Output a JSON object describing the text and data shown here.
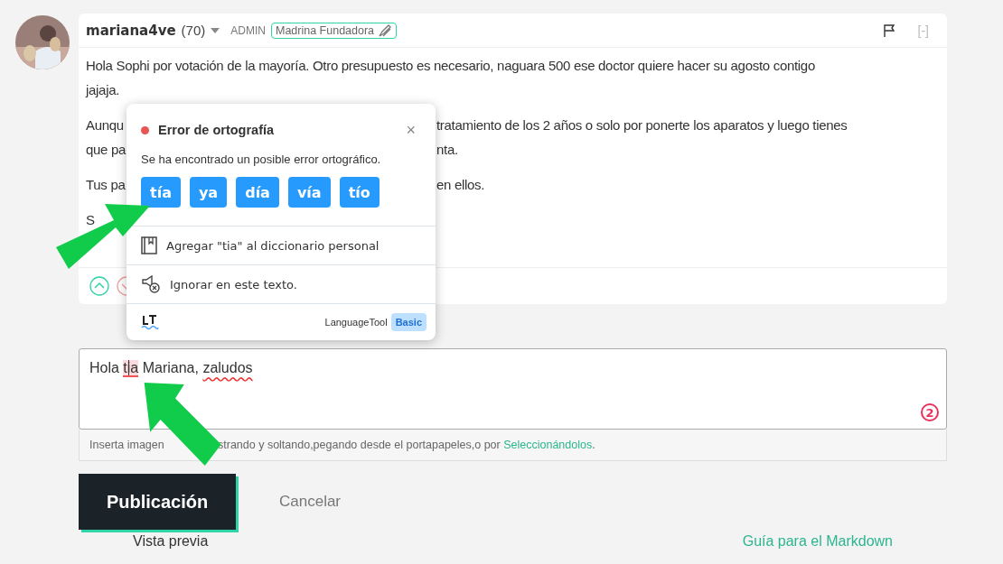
{
  "comment": {
    "author": "mariana4ve",
    "score": "(70)",
    "role": "ADMIN",
    "badge": "Madrina Fundadora",
    "collapse": "[-]",
    "paragraphs": [
      [
        {
          "left": "Hola Sophi por votación de la mayoría. Otro presupuesto es necesario, naguara 500 ese doctor quiere hacer su agosto contigo"
        },
        {
          "left": "jajaja."
        }
      ],
      [
        {
          "left": "Aunqu",
          "right": "tratamiento de los 2 años o solo por ponerte los aparatos y luego tienes"
        },
        {
          "left": "que pa",
          "right": "nta."
        }
      ],
      [
        {
          "left": "Tus pa",
          "right": "en ellos."
        }
      ],
      [
        {
          "left": "S"
        }
      ]
    ]
  },
  "popup": {
    "title": "Error de ortografía",
    "close": "×",
    "message": "Se ha encontrado un posible error ortográfico.",
    "suggestions": [
      "tía",
      "ya",
      "día",
      "vía",
      "tío"
    ],
    "actions": [
      {
        "kind": "dictionary",
        "label": "Agregar \"tia\" al diccionario personal"
      },
      {
        "kind": "ignore",
        "label": "Ignorar en este texto."
      }
    ],
    "brand": "LanguageTool",
    "plan": "Basic"
  },
  "editor": {
    "segments": [
      {
        "kind": "plain",
        "text": "Hola "
      },
      {
        "kind": "error",
        "text": "tia"
      },
      {
        "kind": "plain",
        "text": " Mariana, "
      },
      {
        "kind": "misspelled",
        "text": "zaludos"
      }
    ],
    "error_count": "2",
    "hint_left": "Inserta imagen",
    "hint_right": "strando y soltando,pegando desde el portapapeles,o por",
    "hint_link": "Seleccionándolos",
    "hint_end": "."
  },
  "buttons": {
    "publish": "Publicación",
    "cancel": "Cancelar"
  },
  "preview": {
    "label": "Vista previa",
    "guide_link": "Guía para el Markdown"
  }
}
